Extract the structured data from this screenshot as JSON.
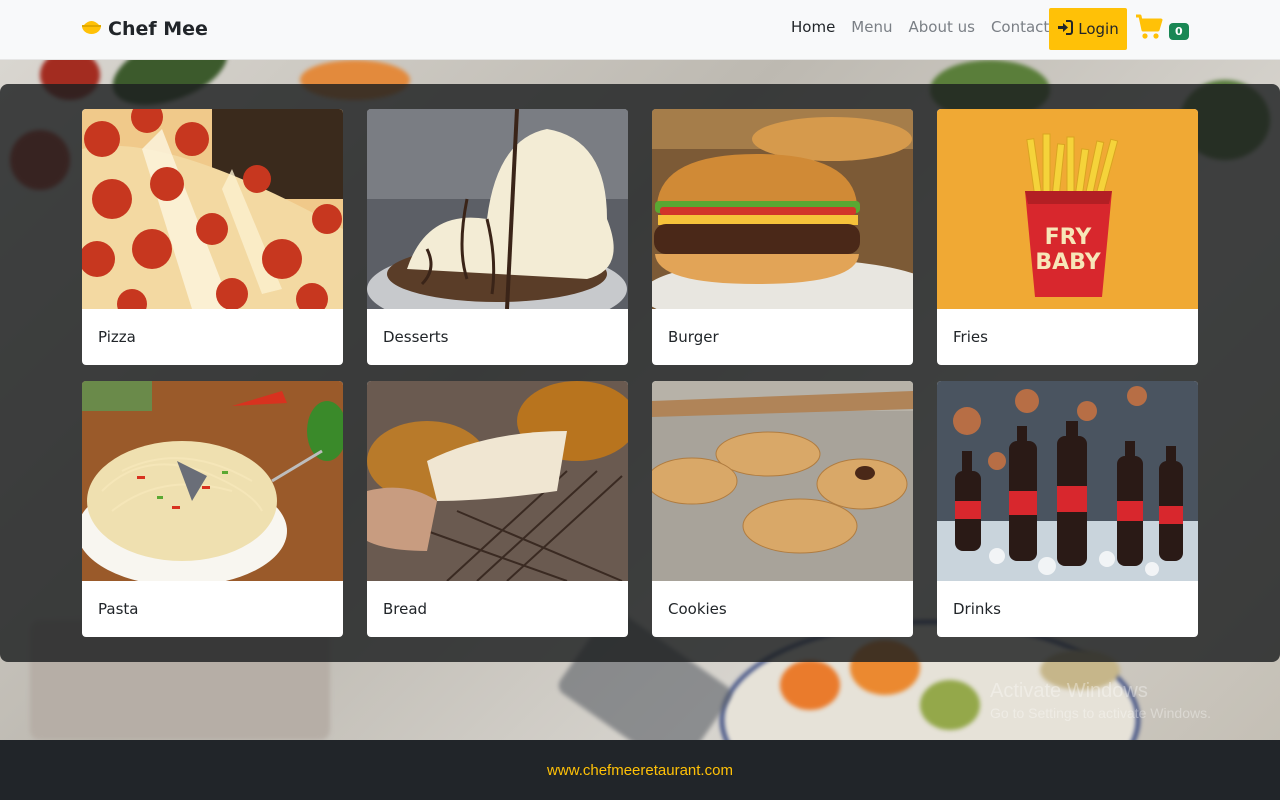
{
  "brand": {
    "name": "Chef Mee",
    "icon": "bowl-icon",
    "accent": "#ffc107"
  },
  "nav": {
    "links": [
      {
        "label": "Home",
        "active": true
      },
      {
        "label": "Menu",
        "active": false
      },
      {
        "label": "About us",
        "active": false
      },
      {
        "label": "Contact",
        "active": false
      }
    ],
    "login_label": "Login",
    "login_icon": "sign-in-icon",
    "cart_icon": "shopping-cart-icon",
    "cart_count": "0"
  },
  "categories": [
    {
      "label": "Pizza",
      "image": "pizza-photo"
    },
    {
      "label": "Desserts",
      "image": "dessert-photo"
    },
    {
      "label": "Burger",
      "image": "burger-photo"
    },
    {
      "label": "Fries",
      "image": "fries-photo"
    },
    {
      "label": "Pasta",
      "image": "pasta-photo"
    },
    {
      "label": "Bread",
      "image": "bread-photo"
    },
    {
      "label": "Cookies",
      "image": "cookies-photo"
    },
    {
      "label": "Drinks",
      "image": "drinks-photo"
    }
  ],
  "fries_image_text": "FRY BABY",
  "footer": {
    "link": "www.chefmeeretaurant.com"
  },
  "watermark": {
    "line1": "Activate Windows",
    "line2": "Go to Settings to activate Windows."
  },
  "colors": {
    "navbar": "#f8f9fa",
    "footer": "#212529",
    "login": "#ffc107",
    "badge": "#198754"
  }
}
